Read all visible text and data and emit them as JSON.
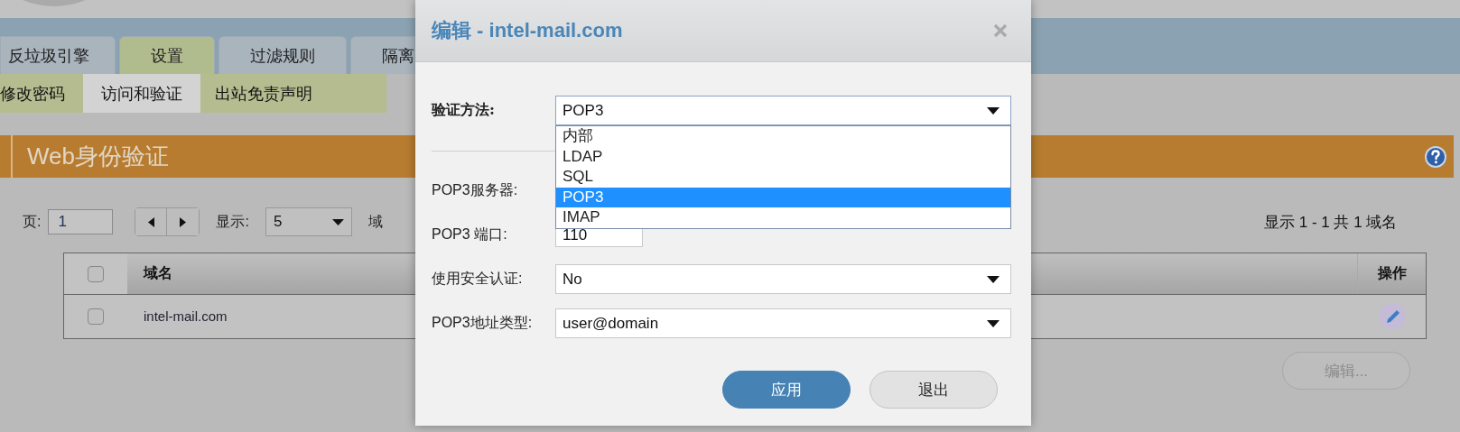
{
  "tabs": [
    {
      "label": "反垃圾引擎",
      "selected": false
    },
    {
      "label": "设置",
      "selected": true
    },
    {
      "label": "过滤规则",
      "selected": false
    },
    {
      "label": "隔离",
      "selected": false
    }
  ],
  "subtabs": [
    {
      "label": "修改密码",
      "selected": false
    },
    {
      "label": "访问和验证",
      "selected": true
    },
    {
      "label": "出站免责声明",
      "selected": false
    }
  ],
  "panel": {
    "title": "Web身份验证",
    "pager": {
      "page_label": "页:",
      "page_value": "1",
      "show_label": "显示:",
      "show_value": "5",
      "domain_label": "域"
    },
    "summary": "显示 1 - 1 共 1 域名",
    "table": {
      "header_checked": false,
      "columns": [
        "域名",
        "操作"
      ],
      "rows": [
        {
          "checked": false,
          "domain": "intel-mail.com"
        }
      ]
    },
    "edit_button": {
      "label": "编辑...",
      "disabled": true
    }
  },
  "dialog": {
    "title": "编辑 - intel-mail.com",
    "fields": [
      {
        "kind": "select",
        "label": "验证方法:",
        "bold": true,
        "value": "POP3",
        "expanded": true,
        "options": [
          {
            "label": "内部",
            "selected": false
          },
          {
            "label": "LDAP",
            "selected": false
          },
          {
            "label": "SQL",
            "selected": false
          },
          {
            "label": "POP3",
            "selected": true
          },
          {
            "label": "IMAP",
            "selected": false
          }
        ]
      },
      {
        "kind": "text",
        "label": "POP3服务器:",
        "bold": false
      },
      {
        "kind": "text",
        "label": "POP3 端口:",
        "bold": false,
        "value": "110"
      },
      {
        "kind": "select",
        "label": "使用安全认证:",
        "bold": false,
        "value": "No",
        "expanded": false
      },
      {
        "kind": "select",
        "label": "POP3地址类型:",
        "bold": false,
        "value": "user@domain",
        "expanded": false
      }
    ],
    "buttons": [
      {
        "label": "应用",
        "primary": true
      },
      {
        "label": "退出",
        "primary": false
      }
    ]
  }
}
